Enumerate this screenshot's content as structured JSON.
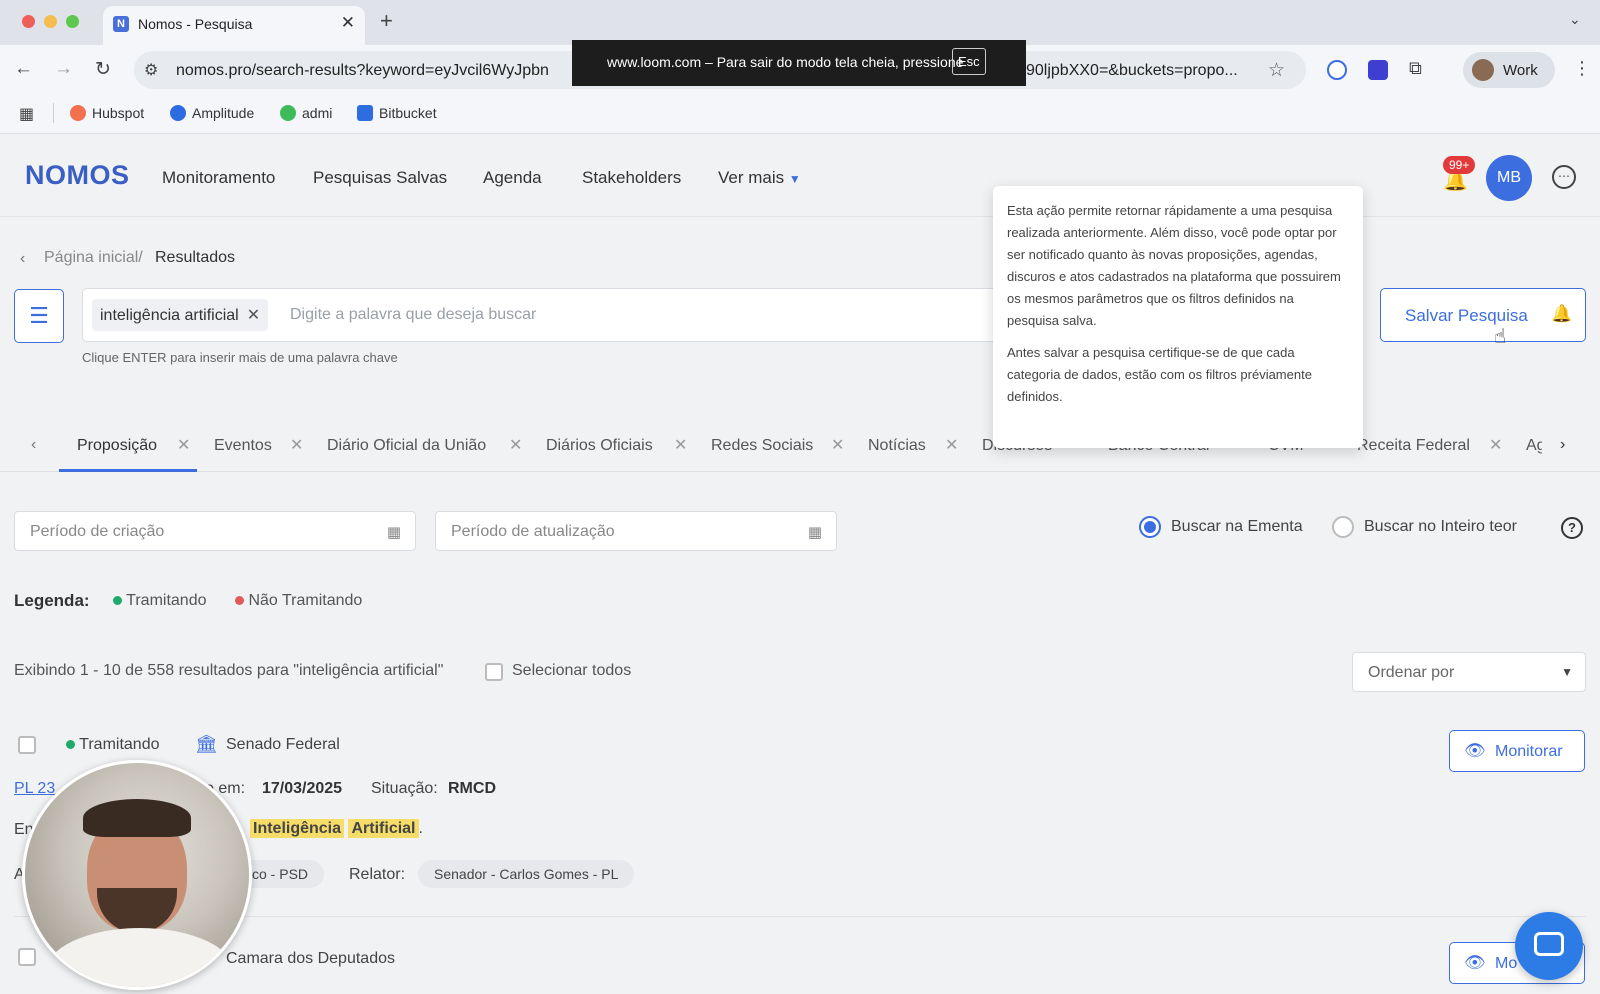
{
  "browser": {
    "tab_title": "Nomos - Pesquisa",
    "url_visible_left": "nomos.pro/search-results?keyword=eyJvcil6WyJpbn",
    "url_visible_right": "90ljpbXX0=&buckets=propo...",
    "fullscreen_notice": "www.loom.com – Para sair do modo tela cheia, pressione",
    "fullscreen_key": "Esc",
    "profile_name": "Work",
    "bookmarks": [
      "Hubspot",
      "Amplitude",
      "admi",
      "Bitbucket"
    ]
  },
  "app": {
    "logo": "NOMOS",
    "menu": [
      "Monitoramento",
      "Pesquisas Salvas",
      "Agenda",
      "Stakeholders",
      "Ver mais"
    ],
    "notifications_badge": "99+",
    "avatar_initials": "MB"
  },
  "breadcrumb": {
    "home": "Página inicial/",
    "current": "Resultados"
  },
  "search": {
    "chip": "inteligência artificial",
    "placeholder": "Digite a palavra que deseja buscar",
    "hint": "Clique ENTER para inserir mais de uma palavra chave",
    "save_label": "Salvar Pesquisa"
  },
  "tooltip": {
    "p1": "Esta ação permite retornar rápidamente a uma pesquisa realizada anteriormente. Além disso, você pode optar por ser notificado quanto às novas proposições, agendas, discuros e atos cadastrados na plataforma que possuirem os mesmos parâmetros que os filtros definidos na pesquisa salva.",
    "p2": "Antes salvar a pesquisa certifique-se de que cada categoria de dados, estão com os filtros préviamente definidos."
  },
  "category_tabs": [
    "Proposição",
    "Eventos",
    "Diário Oficial da União",
    "Diários Oficiais",
    "Redes Sociais",
    "Notícias",
    "Discursos",
    "Banco Central",
    "CVM",
    "Receita Federal",
    "Ag"
  ],
  "filters": {
    "created_placeholder": "Período de criação",
    "updated_placeholder": "Período de atualização",
    "radio_ementa": "Buscar na Ementa",
    "radio_inteiro": "Buscar no Inteiro teor",
    "selected_radio": "Buscar na Ementa"
  },
  "legend": {
    "title": "Legenda:",
    "tramitando": "Tramitando",
    "nao_tramitando": "Não Tramitando",
    "color_tramitando": "#1faa6b",
    "color_nao": "#e05a5a"
  },
  "results": {
    "summary": "Exibindo 1 - 10 de 558 resultados para  \"inteligência artificial\"",
    "select_all": "Selecionar todos",
    "order_by": "Ordenar por",
    "monitor_label": "Monitorar"
  },
  "item1": {
    "status": "Tramitando",
    "house": "Senado Federal",
    "code": "PL 23",
    "date_label": "o em:",
    "date": "17/03/2025",
    "situation_label": "Situação:",
    "situation": "RMCD",
    "em_prefix": "En",
    "hl1": "Inteligência",
    "hl2": "Artificial",
    "hl_suffix": ".",
    "author_prefix": "A",
    "author": "co - PSD",
    "rapporteur_label": "Relator:",
    "rapporteur": "Senador - Carlos Gomes - PL"
  },
  "item2": {
    "house": "Camara dos Deputados",
    "monitor_partial": "Mo"
  }
}
